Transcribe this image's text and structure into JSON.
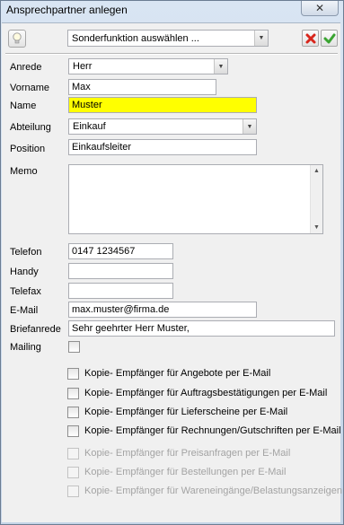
{
  "window": {
    "title": "Ansprechpartner anlegen",
    "close_glyph": "✕"
  },
  "toolbar": {
    "hint_icon": "lightbulb-icon",
    "special_function": {
      "value": "Sonderfunktion auswählen ..."
    },
    "cancel_icon": "red-x-icon",
    "confirm_icon": "green-check-icon"
  },
  "form": {
    "anrede": {
      "label": "Anrede",
      "value": "Herr"
    },
    "vorname": {
      "label": "Vorname",
      "value": "Max"
    },
    "name": {
      "label": "Name",
      "value": "Muster",
      "highlight": "#ffff00"
    },
    "abteilung": {
      "label": "Abteilung",
      "value": "Einkauf"
    },
    "position": {
      "label": "Position",
      "value": "Einkaufsleiter"
    },
    "memo": {
      "label": "Memo",
      "value": ""
    },
    "telefon": {
      "label": "Telefon",
      "value": "0147 1234567"
    },
    "handy": {
      "label": "Handy",
      "value": ""
    },
    "telefax": {
      "label": "Telefax",
      "value": ""
    },
    "email": {
      "label": "E-Mail",
      "value": "max.muster@firma.de"
    },
    "briefanrede": {
      "label": "Briefanrede",
      "value": "Sehr geehrter Herr Muster,"
    },
    "mailing": {
      "label": "Mailing",
      "checked": false
    }
  },
  "copy_options": [
    {
      "label": "Kopie- Empfänger für Angebote per E-Mail",
      "checked": false,
      "enabled": true
    },
    {
      "label": "Kopie- Empfänger für Auftragsbestätigungen per E-Mail",
      "checked": false,
      "enabled": true
    },
    {
      "label": "Kopie- Empfänger für Lieferscheine per E-Mail",
      "checked": false,
      "enabled": true
    },
    {
      "label": "Kopie- Empfänger für Rechnungen/Gutschriften per E-Mail",
      "checked": false,
      "enabled": true
    },
    {
      "label": "Kopie- Empfänger für Preisanfragen per E-Mail",
      "checked": false,
      "enabled": false
    },
    {
      "label": "Kopie- Empfänger für Bestellungen per E-Mail",
      "checked": false,
      "enabled": false
    },
    {
      "label": "Kopie- Empfänger für Wareneingänge/Belastungsanzeigen",
      "checked": false,
      "enabled": false
    }
  ],
  "colors": {
    "name_highlight": "#ffff00",
    "cancel_red": "#d8261c",
    "confirm_green": "#3aa431"
  }
}
